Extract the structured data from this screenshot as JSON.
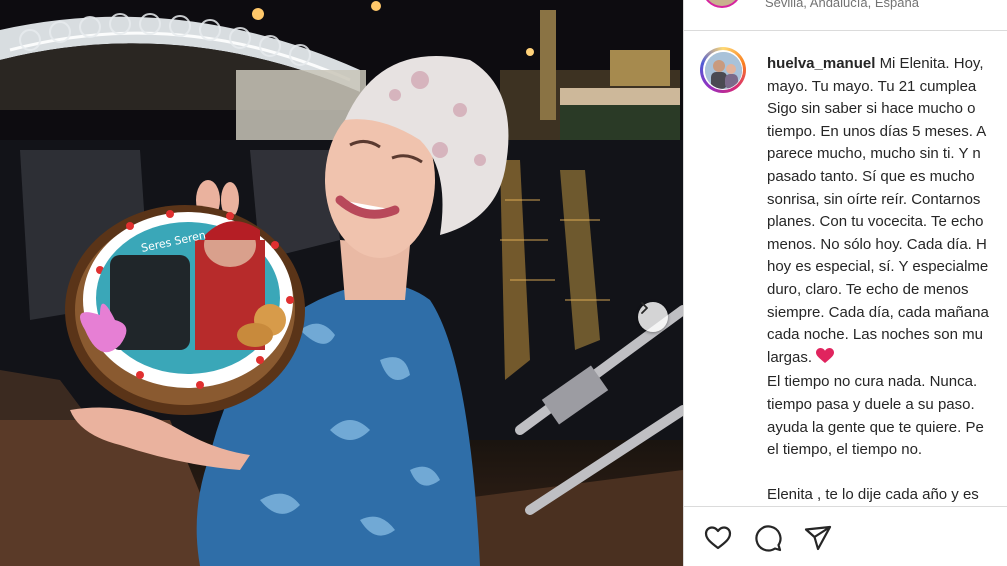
{
  "photo": {
    "cake_text": "Seres Seren",
    "next_icon": "chevron-right-icon"
  },
  "location": {
    "text": "Sevilla, Andalucía, España"
  },
  "caption": {
    "username": "huelva_manuel",
    "lines": [
      "Mi Elenita. Hoy,",
      "mayo. Tu mayo. Tu 21 cumplea",
      "Sigo sin saber si hace mucho o",
      "tiempo. En unos días 5 meses. A",
      "parece mucho, mucho sin ti. Y n",
      "pasado tanto. Sí que es mucho",
      "sonrisa, sin oírte reír. Contarnos",
      "planes. Con tu vocecita. Te echo",
      "menos. No sólo hoy. Cada día. H",
      "hoy es especial, sí. Y especialme",
      "duro, claro. Te echo de menos",
      "siempre. Cada día, cada mañana",
      "cada noche. Las noches son mu",
      "largas.",
      "El tiempo no cura nada. Nunca.",
      "tiempo pasa y duele a su paso.",
      "ayuda la gente que te quiere. Pe",
      "el tiempo, el tiempo no.",
      "",
      "Elenita , te lo dije cada año y es"
    ],
    "emoji": "red-heart-emoji"
  },
  "actions": {
    "like_icon": "heart-icon",
    "comment_icon": "comment-icon",
    "share_icon": "share-icon"
  }
}
